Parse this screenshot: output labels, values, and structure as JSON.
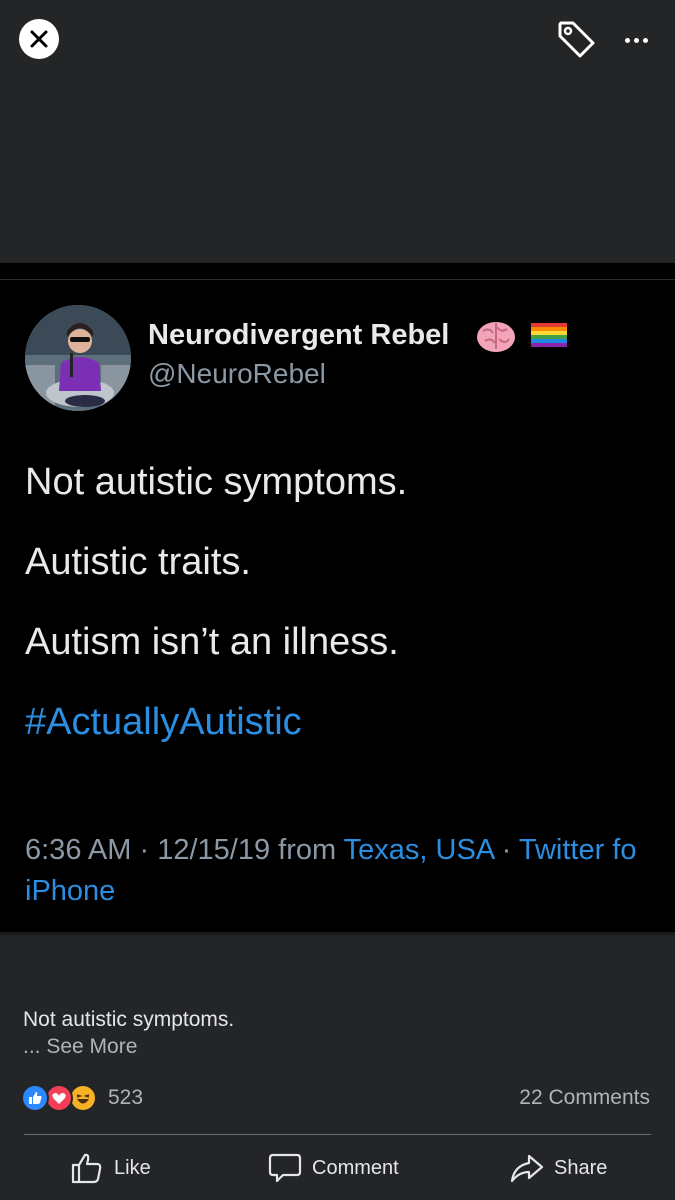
{
  "tweet": {
    "display_name": "Neurodivergent Rebel",
    "handle": "@NeuroRebel",
    "lines": [
      "Not autistic symptoms.",
      "Autistic traits.",
      "Autism isn’t an illness."
    ],
    "hashtag": "#ActuallyAutistic",
    "time": "6:36 AM",
    "sep1": " · ",
    "date": "12/15/19",
    "from": " from ",
    "location": "Texas, USA",
    "sep2": " · ",
    "source_part1": "Twitter fo",
    "source_part2": "iPhone"
  },
  "post": {
    "caption": "Not autistic symptoms.",
    "see_more": "... See More",
    "reaction_count": "523",
    "comments_count": "22 Comments"
  },
  "actions": {
    "like": "Like",
    "comment": "Comment",
    "share": "Share"
  },
  "colors": {
    "background": "#242526",
    "tweet_bg": "#000000",
    "link": "#2b8ee0",
    "muted": "#8b98a5"
  }
}
